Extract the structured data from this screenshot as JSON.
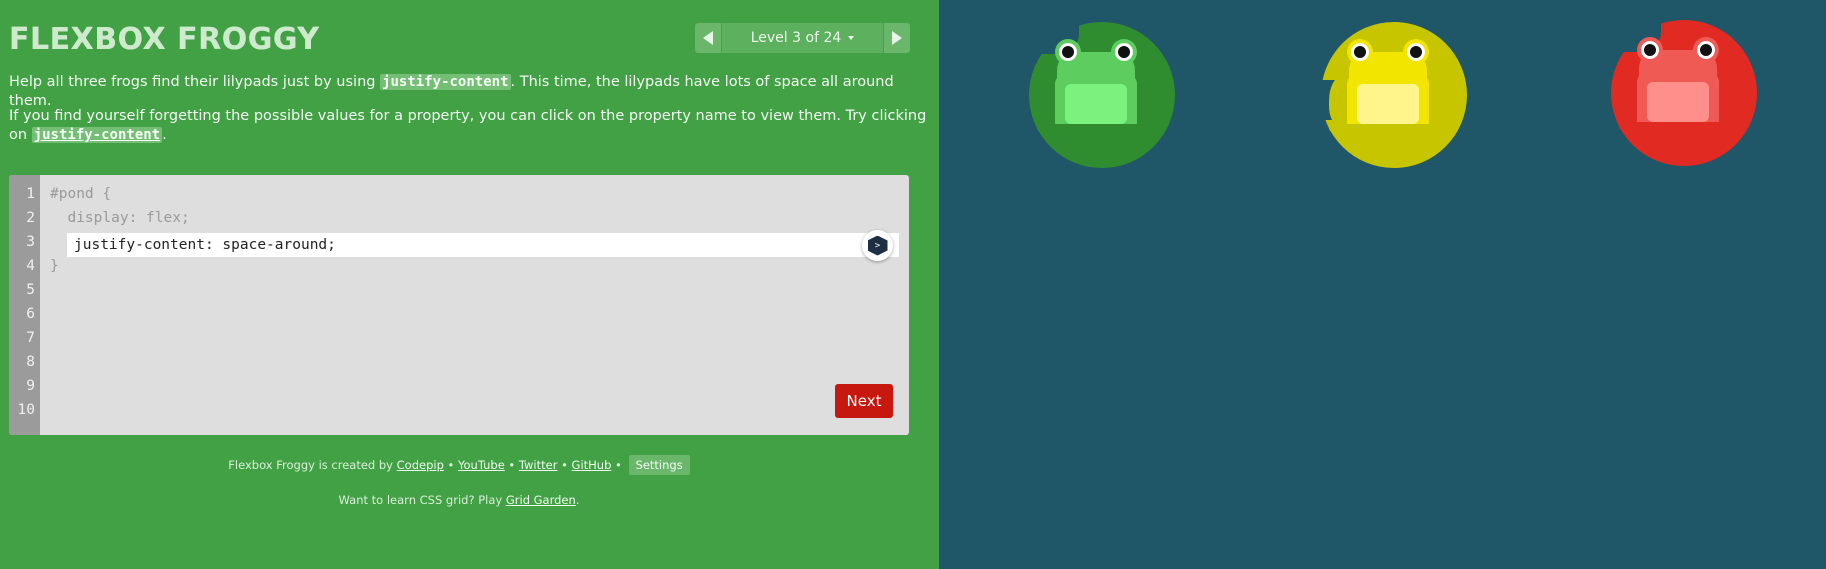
{
  "header": {
    "title": "Flexbox Froggy",
    "level_label": "Level 3 of 24"
  },
  "instructions": {
    "p1_before": "Help all three frogs find their lilypads just by using ",
    "p1_code": "justify-content",
    "p1_after": ". This time, the lilypads have lots of space all around them.",
    "p2_before": "If you find yourself forgetting the possible values for a property, you can click on the property name to view them. Try clicking on ",
    "p2_code": "justify-content",
    "p2_after": "."
  },
  "editor": {
    "line_numbers": [
      "1",
      "2",
      "3",
      "4",
      "5",
      "6",
      "7",
      "8",
      "9",
      "10"
    ],
    "line1": "#pond {",
    "line2": "  display: flex;",
    "input_value": "justify-content: space-around;",
    "line4": "}",
    "emmet_icon_label": ">",
    "next_label": "Next"
  },
  "footer": {
    "created_by": "Flexbox Froggy is created by ",
    "codepip": "Codepip",
    "sep": " • ",
    "youtube": "YouTube",
    "twitter": "Twitter",
    "github": "GitHub",
    "settings": "Settings",
    "grid_before": "Want to learn CSS grid? Play ",
    "grid_link": "Grid Garden",
    "grid_after": "."
  },
  "pond": {
    "frogs": [
      {
        "color": "green",
        "pad": "#2f8d30",
        "skin": "#5ccd5e",
        "belly": "#7cf27e"
      },
      {
        "color": "yellow",
        "pad": "#c7c400",
        "skin": "#f2e500",
        "belly": "#fff58a"
      },
      {
        "color": "red",
        "pad": "#e12a22",
        "skin": "#f05a55",
        "belly": "#ff8f8a"
      }
    ]
  },
  "colors": {
    "sidebar_bg": "#42a045",
    "pond_bg": "#1f5768",
    "next_button": "#c7180f"
  }
}
